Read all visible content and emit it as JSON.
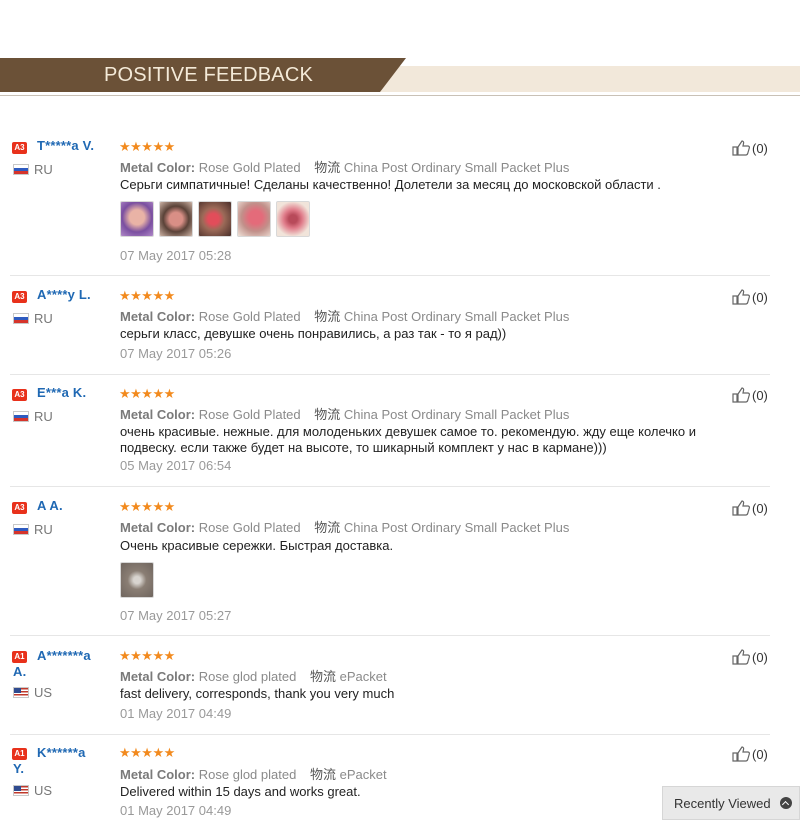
{
  "section": {
    "title": "POSITIVE FEEDBACK"
  },
  "feedback": [
    {
      "badge": "A3",
      "name": "T*****a V.",
      "country": "RU",
      "stars": "★★★★★",
      "color_label": "Metal Color:",
      "color_value": "Rose Gold Plated",
      "ship_label": "物流",
      "ship_value": "China Post Ordinary Small Packet Plus",
      "text": "Серьги симпатичные! Сделаны качественно! Долетели за месяц до московской области .",
      "date": "07 May 2017 05:28",
      "likes": "(0)"
    },
    {
      "badge": "A3",
      "name": "A****y L.",
      "country": "RU",
      "stars": "★★★★★",
      "color_label": "Metal Color:",
      "color_value": "Rose Gold Plated",
      "ship_label": "物流",
      "ship_value": "China Post Ordinary Small Packet Plus",
      "text": "серьги класс, девушке очень понравились, а раз так - то я рад))",
      "date": "07 May 2017 05:26",
      "likes": "(0)"
    },
    {
      "badge": "A3",
      "name": "E***a K.",
      "country": "RU",
      "stars": "★★★★★",
      "color_label": "Metal Color:",
      "color_value": "Rose Gold Plated",
      "ship_label": "物流",
      "ship_value": "China Post Ordinary Small Packet Plus",
      "text": "очень красивые. нежные. для молоденьких девушек самое то. рекомендую. жду еще колечко и подвеску. если также будет на высоте, то шикарный комплект у нас в кармане)))",
      "date": "05 May 2017 06:54",
      "likes": "(0)"
    },
    {
      "badge": "A3",
      "name": "A A.",
      "country": "RU",
      "stars": "★★★★★",
      "color_label": "Metal Color:",
      "color_value": "Rose Gold Plated",
      "ship_label": "物流",
      "ship_value": "China Post Ordinary Small Packet Plus",
      "text": "Очень красивые сережки. Быстрая доставка.",
      "date": "07 May 2017 05:27",
      "likes": "(0)"
    },
    {
      "badge": "A1",
      "name": "A*******a",
      "name2": "A.",
      "country": "US",
      "stars": "★★★★★",
      "color_label": "Metal Color:",
      "color_value": "Rose glod plated",
      "ship_label": "物流",
      "ship_value": "ePacket",
      "text": "fast delivery, corresponds, thank you very much",
      "date": "01 May 2017 04:49",
      "likes": "(0)"
    },
    {
      "badge": "A1",
      "name": "K******a",
      "name2": "Y.",
      "country": "US",
      "stars": "★★★★★",
      "color_label": "Metal Color:",
      "color_value": "Rose glod plated",
      "ship_label": "物流",
      "ship_value": "ePacket",
      "text": "Delivered within 15 days and works great.",
      "date": "01 May 2017 04:49",
      "likes": "(0)"
    }
  ],
  "recently_viewed": {
    "label": "Recently Viewed"
  },
  "colors": {
    "banner_dark": "#6b5137",
    "banner_light": "#f2e8da",
    "star": "#f28a1e",
    "name": "#1f68b3",
    "badge": "#e8311b"
  }
}
